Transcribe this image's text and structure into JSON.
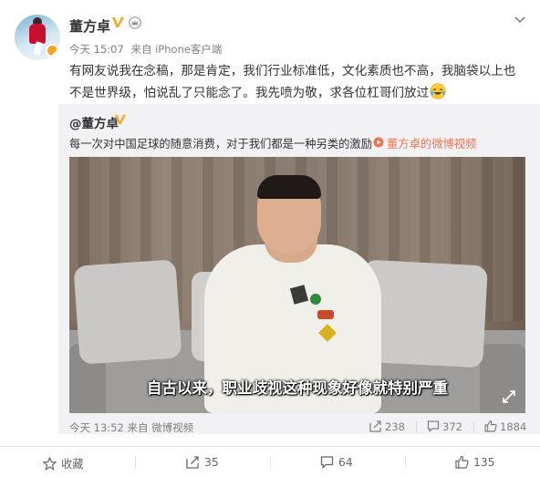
{
  "post": {
    "author": "董方卓",
    "time": "今天 15:07",
    "source_prefix": "来自",
    "source": "iPhone客户端",
    "text": "有网友说我在念稿，那是肯定，我们行业标准低，文化素质也不高，我脑袋以上也不是世界级，怕说乱了只能念了。我先喷为敬，求各位杠哥们放过"
  },
  "repost": {
    "author": "@董方卓",
    "text": "每一次对中国足球的随意消费，对于我们都是一种另类的激励",
    "video_link": "董方卓的微博视频",
    "video_subtitle": "自古以来，职业歧视这种现象好像就特别严重",
    "time": "今天 13:52",
    "source_prefix": "来自",
    "source": "微博视频",
    "reposts": "238",
    "comments": "372",
    "likes": "1884"
  },
  "actions": {
    "favorite": "收藏",
    "repost": "35",
    "comment": "64",
    "like": "135"
  },
  "colors": {
    "link": "#eb7350",
    "verified": "#f6a623",
    "meta": "#808080"
  },
  "icons": [
    "verified-v-icon",
    "crown-icon",
    "chevron-down-icon",
    "laugh-cry-emoji-icon",
    "video-link-icon",
    "fullscreen-icon",
    "share-icon",
    "comment-icon",
    "thumbs-up-icon",
    "star-icon"
  ]
}
